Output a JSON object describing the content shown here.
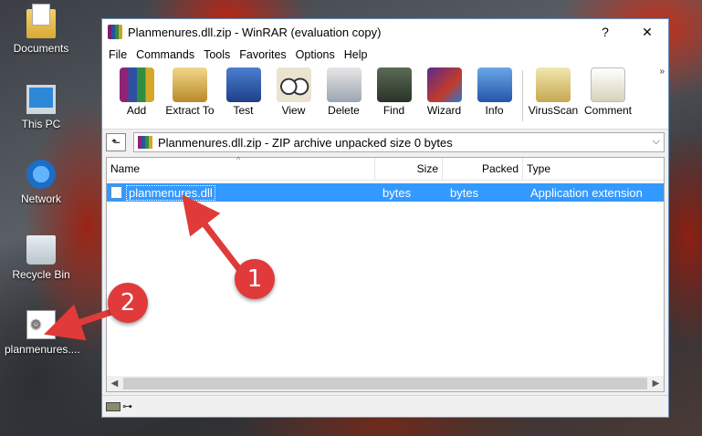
{
  "desktop": {
    "icons": [
      {
        "label": "Documents",
        "icon": "documents-folder-icon"
      },
      {
        "label": "This PC",
        "icon": "computer-icon"
      },
      {
        "label": "Network",
        "icon": "network-icon"
      },
      {
        "label": "Recycle Bin",
        "icon": "recycle-bin-icon"
      },
      {
        "label": "planmenures....",
        "icon": "dll-file-icon"
      }
    ]
  },
  "window": {
    "title": "Planmenures.dll.zip - WinRAR (evaluation copy)",
    "help_glyph": "?",
    "close_glyph": "✕"
  },
  "menu": [
    "File",
    "Commands",
    "Tools",
    "Favorites",
    "Options",
    "Help"
  ],
  "toolbar": {
    "items": [
      {
        "label": "Add",
        "icon": "add-icon"
      },
      {
        "label": "Extract To",
        "icon": "extract-icon"
      },
      {
        "label": "Test",
        "icon": "test-icon"
      },
      {
        "label": "View",
        "icon": "view-icon"
      },
      {
        "label": "Delete",
        "icon": "delete-icon"
      },
      {
        "label": "Find",
        "icon": "find-icon"
      },
      {
        "label": "Wizard",
        "icon": "wizard-icon"
      },
      {
        "label": "Info",
        "icon": "info-icon"
      },
      {
        "label": "VirusScan",
        "icon": "virusscan-icon"
      },
      {
        "label": "Comment",
        "icon": "comment-icon"
      }
    ],
    "more_glyph": "»"
  },
  "address": {
    "up_glyph": "⬑",
    "path": "Planmenures.dll.zip - ZIP archive unpacked size 0 bytes",
    "dropdown_glyph": "⌵"
  },
  "list": {
    "columns": [
      "Name",
      "Size",
      "Packed",
      "Type"
    ],
    "rows": [
      {
        "name": "planmenures.dll",
        "size": "bytes",
        "packed": "bytes",
        "type": "Application extension",
        "selected": true
      }
    ]
  },
  "annotations": {
    "badge1": "1",
    "badge2": "2"
  },
  "colors": {
    "selection": "#3399ff",
    "annotation": "#e03a3a"
  }
}
